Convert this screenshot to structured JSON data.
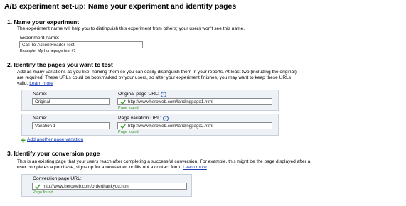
{
  "page_title": "A/B experiment set-up: Name your experiment and identify pages",
  "step1": {
    "heading": "1.  Name your experiment",
    "description": "The experiment name will help you to distinguish this experiment from others; your users won't see this name.",
    "name_label": "Experiment name:",
    "name_value": "Call-To-Action Header Test",
    "example": "Example: My homepage test #1"
  },
  "step2": {
    "heading": "2.  Identify the pages you want to test",
    "description_line1": "Add as many variations as you like, naming them so you can easily distinguish them in your reports. At least two (including the original)",
    "description_line2": "are required. These URLs could be bookmarked by your users, so after your experiment finishes, you may want to keep these URLs",
    "description_line3": "valid.",
    "learn_more": "Learn more",
    "original": {
      "name_label": "Name:",
      "name_value": "Original",
      "url_label": "Original page URL:",
      "help_icon": "?",
      "url_value": "http://www.heroweb.com/landingpage1.html",
      "status": "Page found"
    },
    "variation": {
      "name_label": "Name:",
      "name_value": "Variation 1",
      "url_label": "Page variation URL:",
      "help_icon": "?",
      "url_value": "http://www.heroweb.com/landingpage2.html",
      "status": "Page found"
    },
    "add_variation": "Add another page variation"
  },
  "step3": {
    "heading": "3.  Identify your conversion page",
    "description_line1": "This is an existing page that your users reach after completing a successful conversion. For example, this might be the page displayed after a",
    "description_line2": "user completes a purchase, signs up for a newsletter, or fills out a contact form.",
    "learn_more": "Learn more",
    "url_label": "Conversion page URL:",
    "url_value": "http://www.heroweb.com/orderthankyou.html",
    "status": "Page found"
  },
  "colors": {
    "link": "#1a3fb3",
    "found": "#3a9a2e",
    "box_bg": "#eef1f6",
    "check": "#3a9a2e"
  }
}
